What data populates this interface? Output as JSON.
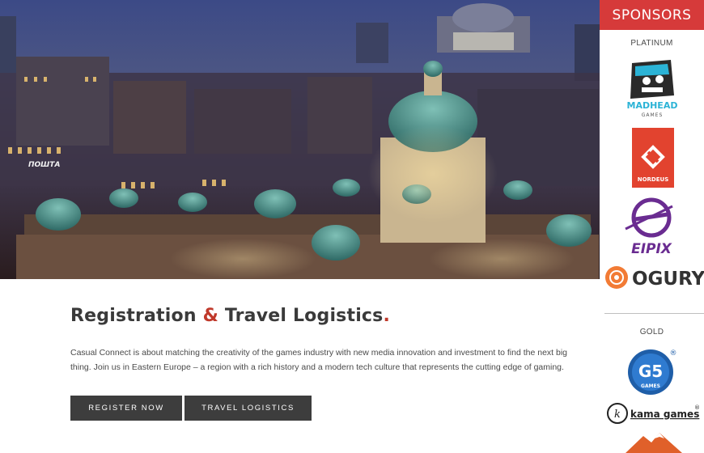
{
  "hero": {
    "sign_text": "ПОШТА"
  },
  "main": {
    "title_part1": "Registration",
    "title_amp": "&",
    "title_part2": "Travel Logistics",
    "title_dot": ".",
    "description": "Casual Connect is about matching the creativity of the games industry with new media innovation and investment to find the next big thing. Join us in Eastern Europe – a region with a rich history and a modern tech culture that represents the cutting edge of gaming.",
    "buttons": {
      "register_label": "REGISTER NOW",
      "travel_label": "TRAVEL LOGISTICS"
    }
  },
  "sidebar": {
    "header": "SPONSORS",
    "platinum_label": "PLATINUM",
    "gold_label": "GOLD",
    "logos": {
      "madhead_line1": "MADHEAD",
      "madhead_line2": "GAMES",
      "nordeus": "NORDEUS",
      "eipix": "EIPIX",
      "ogury": "OGURY",
      "g5": "G5",
      "g5_sub": "GAMES",
      "kama": "kama games",
      "registered": "®"
    }
  },
  "colors": {
    "accent": "#d63a3a",
    "button": "#3d3d3d",
    "text": "#3a3a3a"
  }
}
